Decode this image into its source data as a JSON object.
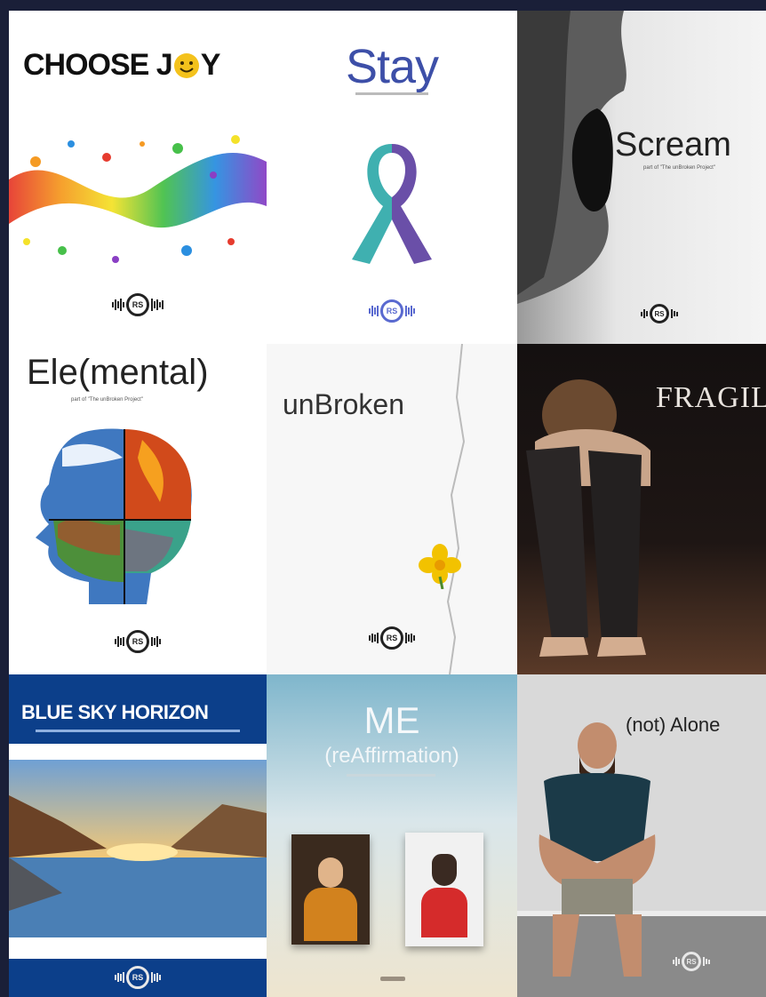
{
  "tiles": [
    {
      "title": "CHOOSE J",
      "title_tail": "Y",
      "logo": "RS"
    },
    {
      "title": "Stay",
      "logo": "RS"
    },
    {
      "title": "Scream",
      "subtitle": "part of \"The unBroken Project\"",
      "logo": "RS"
    },
    {
      "title": "Ele(mental)",
      "subtitle": "part of \"The unBroken Project\"",
      "logo": "RS"
    },
    {
      "title": "unBroken",
      "logo": "RS"
    },
    {
      "title": "FRAGILE"
    },
    {
      "title": "BLUE SKY HORIZON",
      "logo": "RS"
    },
    {
      "title": "ME",
      "subtitle": "(reAffirmation)"
    },
    {
      "title": "(not) Alone",
      "logo": "RS"
    }
  ],
  "colors": {
    "background": "#1a1f38",
    "stay_ribbon_purple": "#6a4fa8",
    "stay_ribbon_teal": "#3fb0b0",
    "blue_sky_title": "#ffffff",
    "joy_smiley": "#f4c21c"
  },
  "icons": [
    "smiley-icon",
    "awareness-ribbon-icon",
    "daisy-flower-icon",
    "rs-logo-icon"
  ]
}
